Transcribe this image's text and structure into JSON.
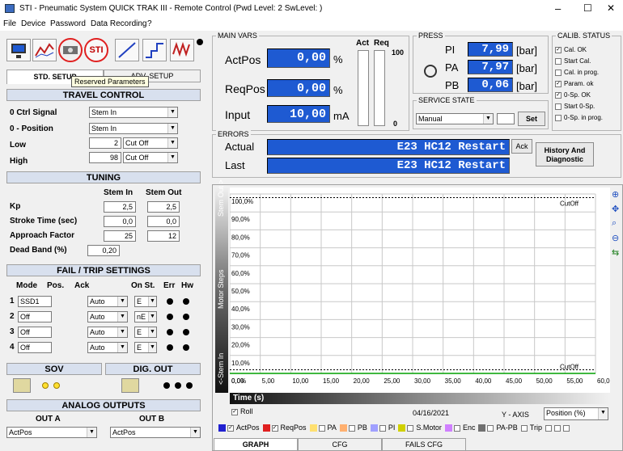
{
  "window": {
    "title": "STI - Pneumatic System QUICK TRAK III - Remote Control  (Pwd Level: 2  SwLevel: )",
    "min": "–",
    "max": "☐",
    "close": "✕"
  },
  "menu": [
    "File",
    "Device",
    "Password",
    "Data Recording",
    "?"
  ],
  "toolbar": {
    "sti_label": "STI",
    "tooltip": "Reserved Parameters"
  },
  "tabs": {
    "std": "STD. SETUP",
    "adv": "ADV. SETUP"
  },
  "travel": {
    "title": "TRAVEL CONTROL",
    "ctrl_label": "0 Ctrl Signal",
    "ctrl_value": "Stem In",
    "pos_label": "0 - Position",
    "pos_value": "Stem In",
    "low_label": "Low",
    "low_value": "2",
    "low_mode": "Cut Off",
    "high_label": "High",
    "high_value": "98",
    "high_mode": "Cut Off"
  },
  "tuning": {
    "title": "TUNING",
    "col1": "Stem In",
    "col2": "Stem Out",
    "kp_label": "Kp",
    "kp_in": "2,5",
    "kp_out": "2,5",
    "stroke_label": "Stroke Time (sec)",
    "stroke_in": "0,0",
    "stroke_out": "0,0",
    "approach_label": "Approach Factor",
    "approach_in": "25",
    "approach_out": "12",
    "dead_label": "Dead Band  (%)",
    "dead_value": "0,20"
  },
  "fail": {
    "title": "FAIL / TRIP SETTINGS",
    "h_mode": "Mode",
    "h_pos": "Pos.",
    "h_ack": "Ack",
    "h_on": "On St.",
    "h_err": "Err",
    "h_hw": "Hw",
    "rows": [
      {
        "n": "1",
        "mode": "SSD1",
        "ack": "Auto",
        "on": "E"
      },
      {
        "n": "2",
        "mode": "Off",
        "ack": "Auto",
        "on": "nE"
      },
      {
        "n": "3",
        "mode": "Off",
        "ack": "Auto",
        "on": "E"
      },
      {
        "n": "4",
        "mode": "Off",
        "ack": "Auto",
        "on": "E"
      }
    ]
  },
  "sov": {
    "title": "SOV"
  },
  "digout": {
    "title": "DIG. OUT"
  },
  "analog": {
    "title": "ANALOG OUTPUTS",
    "out_a": "OUT A",
    "out_b": "OUT B",
    "a_value": "ActPos",
    "b_value": "ActPos"
  },
  "mainvars": {
    "title": "MAIN VARS",
    "act_label": "Act",
    "req_label": "Req",
    "scale_top": "100",
    "scale_bottom": "0",
    "actpos_label": "ActPos",
    "actpos_value": "0,00",
    "actpos_unit": "%",
    "reqpos_label": "ReqPos",
    "reqpos_value": "0,00",
    "reqpos_unit": "%",
    "input_label": "Input",
    "input_value": "10,00",
    "input_unit": "mA"
  },
  "press": {
    "title": "PRESS",
    "pi_label": "PI",
    "pi_value": "7,99",
    "pa_label": "PA",
    "pa_value": "7,97",
    "pb_label": "PB",
    "pb_value": "0,06",
    "unit": "[bar]"
  },
  "service": {
    "title": "SERVICE STATE",
    "value": "Manual",
    "set": "Set"
  },
  "calib": {
    "title": "CALIB. STATUS",
    "items": [
      {
        "label": "Cal. OK",
        "checked": "✓"
      },
      {
        "label": "Start Cal.",
        "checked": ""
      },
      {
        "label": "Cal. in prog.",
        "checked": ""
      },
      {
        "label": "Param. ok",
        "checked": "✓"
      },
      {
        "label": "0-Sp. OK",
        "checked": "✓"
      },
      {
        "label": "Start 0-Sp.",
        "checked": ""
      },
      {
        "label": "0-Sp. in prog.",
        "checked": ""
      }
    ]
  },
  "errors": {
    "title": "ERRORS",
    "actual_label": "Actual",
    "actual_value": "E23 HC12 Restart",
    "last_label": "Last",
    "last_value": "E23 HC12 Restart",
    "ack": "Ack",
    "history": "History And\nDiagnostic"
  },
  "graph": {
    "side_top": "Stem Out >",
    "side_mid": "Motor Steps",
    "side_bot": "<-Stem In",
    "cutoff_top": "CutOff",
    "cutoff_bot": "CutOff",
    "time_label": "Time (s)",
    "roll": "Roll",
    "date": "04/16/2021",
    "yaxis_label": "Y - AXIS",
    "yaxis_value": "Position (%)"
  },
  "chart_data": {
    "type": "line",
    "xlabel": "Time (s)",
    "ylabel": "",
    "x_ticks": [
      "0,00",
      "5,00",
      "10,00",
      "15,00",
      "20,00",
      "25,00",
      "30,00",
      "35,00",
      "40,00",
      "45,00",
      "50,00",
      "55,00",
      "60,00"
    ],
    "y_ticks": [
      "0,0%",
      "10,0%",
      "20,0%",
      "30,0%",
      "40,0%",
      "50,0%",
      "60,0%",
      "70,0%",
      "80,0%",
      "90,0%",
      "100,0%"
    ],
    "xlim": [
      0,
      60
    ],
    "ylim": [
      0,
      100
    ],
    "cutoff_high": 98,
    "cutoff_low": 2,
    "series": [
      {
        "name": "ActPos",
        "color": "#00a000",
        "x": [
          0,
          60
        ],
        "y": [
          0,
          0
        ]
      }
    ]
  },
  "legend": [
    {
      "label": "ActPos",
      "color": "#2020d0",
      "checked": "✓"
    },
    {
      "label": "ReqPos",
      "color": "#e02020",
      "checked": "✓"
    },
    {
      "label": "PA",
      "color": "#ffe070",
      "checked": ""
    },
    {
      "label": "PB",
      "color": "#ffb070",
      "checked": ""
    },
    {
      "label": "PI",
      "color": "#a0a0ff",
      "checked": ""
    },
    {
      "label": "S.Motor",
      "color": "#d0d000",
      "checked": ""
    },
    {
      "label": "Enc",
      "color": "#d080ff",
      "checked": ""
    },
    {
      "label": "PA-PB",
      "color": "#707070",
      "checked": ""
    },
    {
      "label": "Trip",
      "color": "",
      "checked": ""
    }
  ],
  "bottomtabs": [
    "GRAPH",
    "CFG",
    "FAILS CFG"
  ]
}
